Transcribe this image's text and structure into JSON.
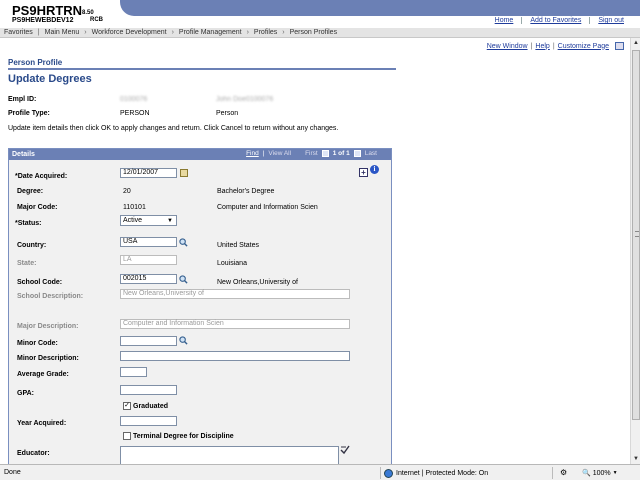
{
  "header": {
    "app_title": "PS9HRTRN",
    "app_version": "8.50",
    "db_name": "PS9HEWEBDEV12",
    "user_code": "RCB",
    "links": [
      "Home",
      "Add to Favorites",
      "Sign out"
    ]
  },
  "menu": {
    "items": [
      "Favorites",
      "Main Menu",
      "Workforce Development",
      "Profile Management",
      "Profiles",
      "Person Profiles"
    ]
  },
  "page_links": {
    "new_window": "New Window",
    "help": "Help",
    "customize_page": "Customize Page",
    "separator": "|"
  },
  "breadcrumb_title": "Person Profile",
  "page_title": "Update Degrees",
  "empl_id": {
    "label": "Empl ID:",
    "value": "0100076",
    "name": "John Doe0100076"
  },
  "profile_type": {
    "label": "Profile Type:",
    "value": "PERSON",
    "description": "Person"
  },
  "instructions": "Update item details then click OK to apply changes and return. Click Cancel to return without any changes.",
  "details": {
    "header": "Details",
    "find": "Find",
    "view_all": "View All",
    "first": "First",
    "pager": "1 of 1",
    "last": "Last",
    "date_acquired": {
      "label": "*Date Acquired:",
      "value": "12/01/2007"
    },
    "degree": {
      "label": "Degree:",
      "code": "20",
      "description": "Bachelor's Degree"
    },
    "major_code": {
      "label": "Major Code:",
      "code": "110101",
      "description": "Computer and Information Scien"
    },
    "status": {
      "label": "*Status:",
      "value": "Active"
    },
    "country": {
      "label": "Country:",
      "value": "USA",
      "description": "United States"
    },
    "state": {
      "label": "State:",
      "value": "LA",
      "description": "Louisiana"
    },
    "school_code": {
      "label": "School Code:",
      "value": "002015",
      "description": "New Orleans,University of"
    },
    "school_description": {
      "label": "School Description:",
      "value": "New Orleans,University of"
    },
    "major_description": {
      "label": "Major Description:",
      "value": "Computer and Information Scien"
    },
    "minor_code": {
      "label": "Minor Code:",
      "value": ""
    },
    "minor_description": {
      "label": "Minor Description:",
      "value": ""
    },
    "average_grade": {
      "label": "Average Grade:",
      "value": ""
    },
    "gpa": {
      "label": "GPA:",
      "value": ""
    },
    "graduated": {
      "label": "Graduated",
      "checked": true
    },
    "year_acquired": {
      "label": "Year Acquired:",
      "value": ""
    },
    "terminal_degree": {
      "label": "Terminal Degree for Discipline",
      "checked": false
    },
    "educator": {
      "label": "Educator:",
      "value": ""
    }
  },
  "statusbar": {
    "done": "Done",
    "zone": "Internet | Protected Mode: On",
    "zoom": "100%"
  },
  "colors": {
    "banner": "#6b80b5",
    "title_blue": "#2a4a8a",
    "link_blue": "#1f3c9c",
    "details_bg": "#f1f1f1"
  }
}
